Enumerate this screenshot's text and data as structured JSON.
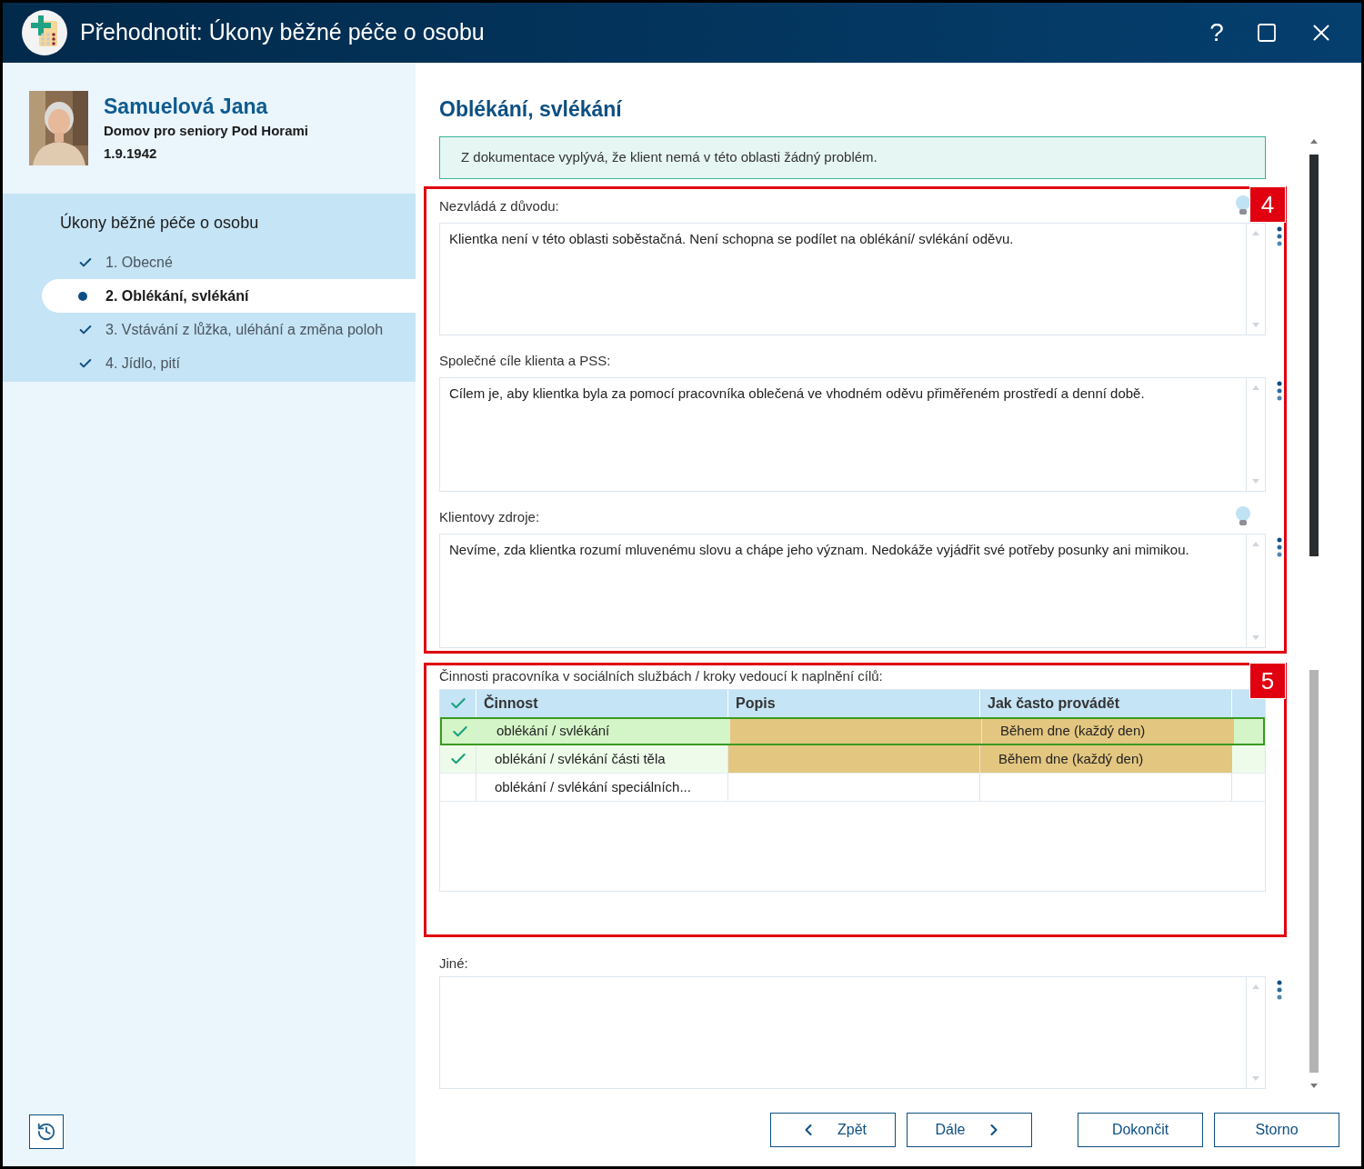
{
  "window": {
    "title": "Přehodnotit: Úkony běžné péče o osobu",
    "help": "?"
  },
  "client": {
    "name": "Samuelová Jana",
    "facility": "Domov pro seniory Pod Horami",
    "birth_date": "1.9.1942"
  },
  "nav": {
    "title": "Úkony běžné péče o osobu",
    "items": [
      {
        "label": "1. Obecné",
        "selected": false,
        "done": true
      },
      {
        "label": "2. Oblékání, svlékání",
        "selected": true,
        "done": false
      },
      {
        "label": "3. Vstávání z lůžka, uléhání a změna poloh",
        "selected": false,
        "done": true
      },
      {
        "label": "4. Jídlo, pití",
        "selected": false,
        "done": true
      }
    ]
  },
  "section": {
    "title": "Oblékání, svlékání",
    "info": "Z dokumentace vyplývá, že klient nemá v této oblasti žádný problém."
  },
  "field_group": {
    "callout": "4",
    "fields": [
      {
        "label": "Nezvládá z důvodu:",
        "value": "Klientka není v této oblasti soběstačná. Není schopna se podílet na oblékání/ svlékání oděvu.",
        "hint": true
      },
      {
        "label": "Společné cíle klienta a PSS:",
        "value": "Cílem je, aby klientka byla za pomocí pracovníka oblečená ve vhodném oděvu přiměřeném prostředí a denní době.",
        "hint": false
      },
      {
        "label": "Klientovy zdroje:",
        "value": "Nevíme, zda klientka rozumí mluvenému slovu a chápe jeho význam. Nedokáže vyjádřit své potřeby posunky ani mimikou.",
        "hint": true
      }
    ]
  },
  "activities": {
    "callout": "5",
    "label": "Činnosti pracovníka v sociálních službách / kroky vedoucí k naplnění cílů:",
    "columns": [
      "Činnost",
      "Popis",
      "Jak často provádět"
    ],
    "rows": [
      {
        "activity": "oblékání / svlékání",
        "frequency": "Během dne (každý den)",
        "checked": true,
        "selected": true
      },
      {
        "activity": "oblékání / svlékání části těla",
        "frequency": "Během dne (každý den)",
        "checked": true,
        "selected": false
      },
      {
        "activity": "oblékání / svlékání speciálních...",
        "checked": false,
        "selected": false
      }
    ]
  },
  "other_field": {
    "label": "Jiné:"
  },
  "buttons": [
    {
      "label": "Zpět",
      "kind": "back"
    },
    {
      "label": "Dále",
      "kind": "next"
    },
    {
      "label": "Dokončit",
      "kind": "plain"
    },
    {
      "label": "Storno",
      "kind": "plain"
    }
  ]
}
